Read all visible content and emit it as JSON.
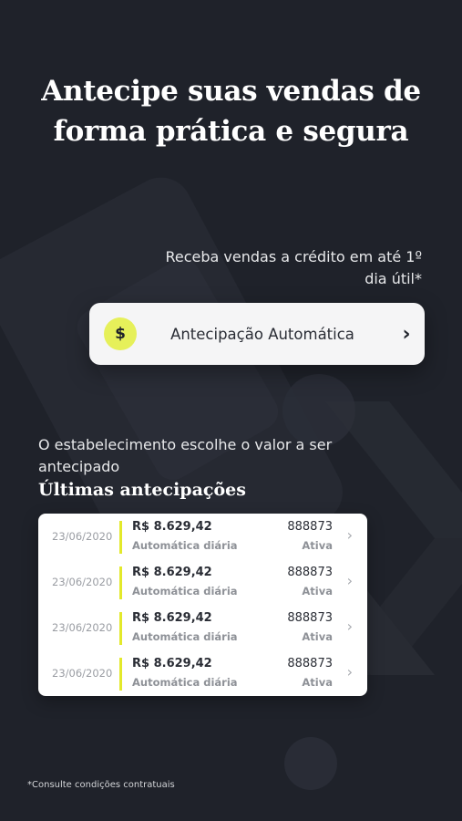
{
  "headline": "Antecipe suas vendas de forma prática e segura",
  "sub_text": "Receba vendas a crédito em até 1º dia útil*",
  "feature_card": {
    "icon": "dollar-refresh-icon",
    "label": "Antecipação Automática",
    "chevron": "chevron-right-icon"
  },
  "description": "O estabelecimento escolhe o valor a ser antecipado",
  "section_title": "Últimas antecipações",
  "rows": [
    {
      "date": "23/06/2020",
      "amount": "R$ 8.629,42",
      "type": "Automática diária",
      "code": "888873",
      "status": "Ativa"
    },
    {
      "date": "23/06/2020",
      "amount": "R$ 8.629,42",
      "type": "Automática diária",
      "code": "888873",
      "status": "Ativa"
    },
    {
      "date": "23/06/2020",
      "amount": "R$ 8.629,42",
      "type": "Automática diária",
      "code": "888873",
      "status": "Ativa"
    },
    {
      "date": "23/06/2020",
      "amount": "R$ 8.629,42",
      "type": "Automática diária",
      "code": "888873",
      "status": "Ativa"
    }
  ],
  "footnote": "*Consulte condições contratuais",
  "colors": {
    "background": "#1f222a",
    "accent": "#e3e92b",
    "card": "#ffffff"
  }
}
